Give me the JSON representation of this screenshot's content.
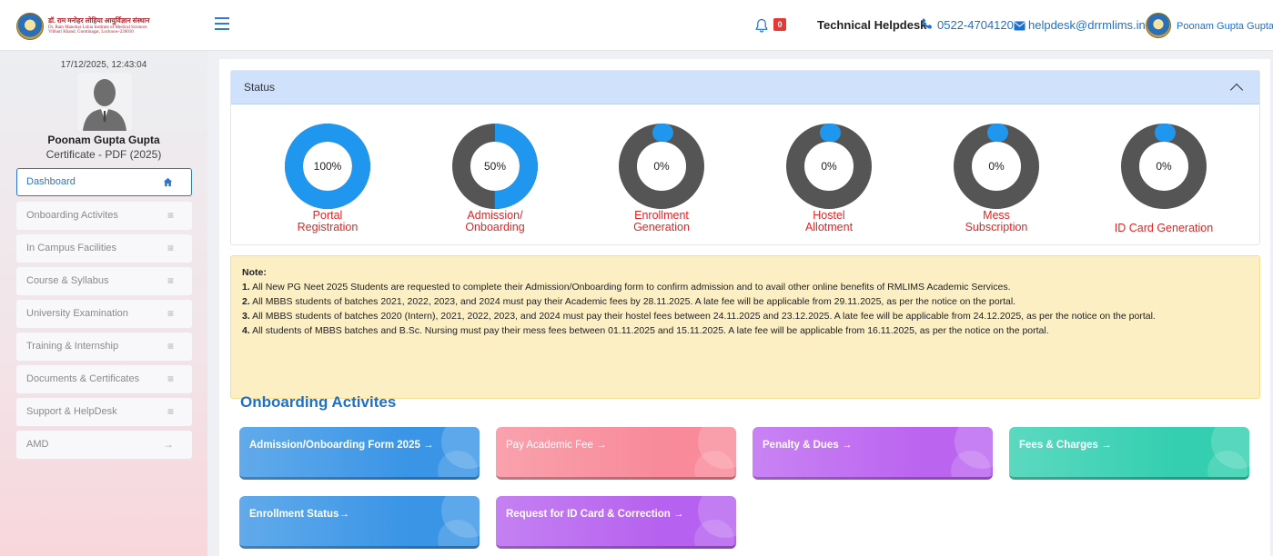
{
  "header": {
    "logo_line1": "डॉ. राम मनोहर लोहिया आयुर्विज्ञान संस्थान",
    "logo_line2": "Dr. Ram Manohar Lohia Institute of Medical Sciences",
    "logo_line3": "Vibhuti Khand, Gomtinagar, Lucknow-226010",
    "notification_count": "0",
    "helpdesk_label": "Technical Helpdesk",
    "phone": "0522-4704120",
    "email": "helpdesk@drrmlims.in",
    "user_name": "Poonam Gupta Gupta ▾"
  },
  "sidebar": {
    "datetime": "17/12/2025, 12:43:04",
    "name": "Poonam Gupta Gupta",
    "program": "Certificate - PDF (2025)",
    "items": [
      {
        "label": "Dashboard",
        "icon": "home-icon"
      },
      {
        "label": "Onboarding Activites",
        "icon": "menu-icon"
      },
      {
        "label": "In Campus Facilities",
        "icon": "menu-icon"
      },
      {
        "label": "Course & Syllabus",
        "icon": "menu-icon"
      },
      {
        "label": "University Examination",
        "icon": "menu-icon"
      },
      {
        "label": "Training & Internship",
        "icon": "menu-icon"
      },
      {
        "label": "Documents & Certificates",
        "icon": "menu-icon"
      },
      {
        "label": "Support & HelpDesk",
        "icon": "menu-icon"
      },
      {
        "label": "AMD",
        "icon": "arrow-right-icon"
      }
    ]
  },
  "status": {
    "title": "Status",
    "items": [
      {
        "value": "100%",
        "progress": 1.0,
        "label1": "Portal",
        "label2": "Registration"
      },
      {
        "value": "50%",
        "progress": 0.5,
        "label1": "Admission/",
        "label2": "Onboarding"
      },
      {
        "value": "0%",
        "progress": 0.0,
        "label1": "Enrollment",
        "label2": "Generation"
      },
      {
        "value": "0%",
        "progress": 0.0,
        "label1": "Hostel",
        "label2": "Allotment"
      },
      {
        "value": "0%",
        "progress": 0.0,
        "label1": "Mess",
        "label2": "Subscription"
      },
      {
        "value": "0%",
        "progress": 0.0,
        "label1": "ID Card Generation",
        "label2": ""
      }
    ],
    "colors": {
      "fill": "#1f97ee",
      "track": "#555555"
    }
  },
  "note": {
    "title": "Note:",
    "lines": [
      {
        "num": "1.",
        "text": "All New PG Neet 2025 Students are requested to complete their Admission/Onboarding form to confirm admission and to avail other online benefits of RMLIMS Academic Services."
      },
      {
        "num": "2.",
        "text": "All MBBS students of batches 2021, 2022, 2023, and 2024 must pay their Academic fees by 28.11.2025. A late fee will be applicable from 29.11.2025, as per the notice on the portal."
      },
      {
        "num": "3.",
        "text": "All MBBS students of batches 2020 (Intern), 2021, 2022, 2023, and 2024 must pay their hostel fees between 24.11.2025 and 23.12.2025. A late fee will be applicable from 24.12.2025, as per the notice on the portal."
      },
      {
        "num": "4.",
        "text": "All students of MBBS batches and B.Sc. Nursing must pay their mess fees between 01.11.2025 and 15.11.2025. A late fee will be applicable from 16.11.2025, as per the notice on the portal."
      }
    ]
  },
  "onboarding": {
    "title": "Onboarding Activites",
    "cards": [
      {
        "label": "Admission/Onboarding Form 2025 →",
        "bold": true
      },
      {
        "label": "Pay Academic Fee →",
        "bold": false
      },
      {
        "label": "Penalty & Dues →",
        "bold": true
      },
      {
        "label": "Fees & Charges →",
        "bold": true
      },
      {
        "label": "Enrollment Status→",
        "bold": true
      },
      {
        "label": "Request for ID Card & Correction →",
        "bold": true
      }
    ],
    "card_colors": [
      "#3a95e6",
      "#f88a99",
      "#bb64f0",
      "#33cfb0",
      "#3a95e6",
      "#b661ef"
    ]
  }
}
